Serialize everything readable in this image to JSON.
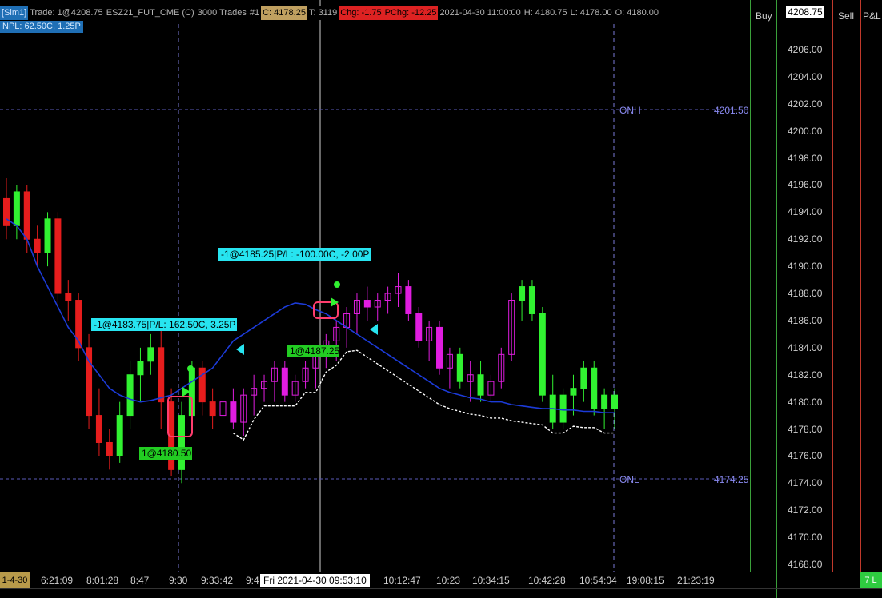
{
  "header": {
    "sim": "[Sim1]",
    "trade": "Trade: 1@4208.75",
    "instrument": "ESZ21_FUT_CME (C)",
    "bars": "3000 Trades",
    "num": "#1",
    "close": "C: 4178.25",
    "t": "T: 3119",
    "chg": "Chg: -1.75",
    "pchg": "PChg: -12.25",
    "datetime": "2021-04-30 11:00:00",
    "high": "H: 4180.75",
    "low": "L: 4178.00",
    "open": "O: 4180.00"
  },
  "npl": "NPL: 62.50C, 1.25P",
  "columns": {
    "buy": "Buy",
    "sell": "Sell",
    "pnl": "P&L"
  },
  "current_price": "4208.75",
  "pnl_badge": "7 L",
  "date_left": "1-4-30",
  "crosshair_date": "Fri 2021-04-30  09:53:10",
  "colors": {
    "bull": "#31f231",
    "bear": "#e61d1d",
    "up_trend": "#e01de0",
    "cyan": "#27e4f0",
    "ma": "#1c3bd8",
    "grid": "#5a5ab8"
  },
  "levels": [
    {
      "name": "ONH",
      "value": "4201.50"
    },
    {
      "name": "ONL",
      "value": "4174.25"
    }
  ],
  "annotations": [
    {
      "text": "-1@4185.25|P/L: -100.00C, -2.00P",
      "kind": "exit"
    },
    {
      "text": "-1@4183.75|P/L: 162.50C, 3.25P",
      "kind": "exit"
    },
    {
      "text": "1@4187.25",
      "kind": "entry"
    },
    {
      "text": "1@4180.50",
      "kind": "entry"
    }
  ],
  "chart_data": {
    "type": "candlestick",
    "y_ticks": [
      "4206.00",
      "4204.00",
      "4202.00",
      "4200.00",
      "4198.00",
      "4196.00",
      "4194.00",
      "4192.00",
      "4190.00",
      "4188.00",
      "4186.00",
      "4184.00",
      "4182.00",
      "4180.00",
      "4178.00",
      "4176.00",
      "4174.00",
      "4172.00",
      "4170.00",
      "4168.00"
    ],
    "y_range": [
      4167,
      4208
    ],
    "x_ticks": [
      "6:21:09",
      "8:01:28",
      "8:47",
      "9:30",
      "9:33:42",
      "9:4",
      "10:12:47",
      "10:23",
      "10:34:15",
      "10:42:28",
      "10:54:04",
      "19:08:15",
      "21:23:19"
    ],
    "candles": [
      [
        4195,
        4196.5,
        4192,
        4193
      ],
      [
        4193,
        4196,
        4192,
        4195.5
      ],
      [
        4195.5,
        4196,
        4191,
        4192
      ],
      [
        4192,
        4193,
        4190,
        4191
      ],
      [
        4191,
        4194,
        4190,
        4193.5
      ],
      [
        4193.5,
        4194,
        4187,
        4188
      ],
      [
        4188,
        4189,
        4186,
        4187.5
      ],
      [
        4187.5,
        4188,
        4183,
        4184
      ],
      [
        4184,
        4185,
        4178,
        4179
      ],
      [
        4179,
        4181,
        4176,
        4177
      ],
      [
        4177,
        4178,
        4175,
        4176
      ],
      [
        4176,
        4180,
        4175.5,
        4179
      ],
      [
        4179,
        4183,
        4178,
        4182
      ],
      [
        4182,
        4184,
        4180,
        4183
      ],
      [
        4183,
        4185,
        4182,
        4184
      ],
      [
        4184,
        4185.5,
        4178,
        4180
      ],
      [
        4180,
        4181,
        4174.5,
        4175
      ],
      [
        4175,
        4180,
        4174,
        4179
      ],
      [
        4179,
        4183,
        4178,
        4182.5
      ],
      [
        4182.5,
        4183,
        4179,
        4180
      ],
      [
        4180,
        4181,
        4178,
        4179
      ],
      [
        4179,
        4181,
        4177,
        4180
      ],
      [
        4180,
        4181,
        4178,
        4178.5
      ],
      [
        4178.5,
        4181,
        4177.5,
        4180.5
      ],
      [
        4180.5,
        4182,
        4179,
        4181
      ],
      [
        4181,
        4182,
        4180,
        4181.5
      ],
      [
        4181.5,
        4183,
        4180,
        4182.5
      ],
      [
        4182.5,
        4183,
        4180,
        4180.5
      ],
      [
        4180.5,
        4182,
        4180,
        4181.5
      ],
      [
        4181.5,
        4183,
        4181,
        4182.5
      ],
      [
        4182.5,
        4184,
        4181,
        4183.5
      ],
      [
        4183.5,
        4185,
        4182.5,
        4184.5
      ],
      [
        4184.5,
        4186,
        4183,
        4185.5
      ],
      [
        4185.5,
        4187,
        4184,
        4186.5
      ],
      [
        4186.5,
        4188,
        4185,
        4187.5
      ],
      [
        4187.5,
        4188.5,
        4186,
        4187
      ],
      [
        4187,
        4188,
        4186,
        4187.5
      ],
      [
        4187.5,
        4188.5,
        4186.5,
        4188
      ],
      [
        4188,
        4189.5,
        4187,
        4188.5
      ],
      [
        4188.5,
        4189,
        4186,
        4186.5
      ],
      [
        4186.5,
        4187,
        4184,
        4184.5
      ],
      [
        4184.5,
        4186,
        4183,
        4185.5
      ],
      [
        4185.5,
        4186,
        4182,
        4182.5
      ],
      [
        4182.5,
        4184,
        4181,
        4183.5
      ],
      [
        4183.5,
        4184,
        4181,
        4181.5
      ],
      [
        4181.5,
        4183,
        4180,
        4182
      ],
      [
        4182,
        4183,
        4180,
        4180.5
      ],
      [
        4180.5,
        4182,
        4180,
        4181.5
      ],
      [
        4181.5,
        4184,
        4181,
        4183.5
      ],
      [
        4183.5,
        4188,
        4183,
        4187.5
      ],
      [
        4187.5,
        4189,
        4186,
        4188.5
      ],
      [
        4188.5,
        4189,
        4186,
        4186.5
      ],
      [
        4186.5,
        4187,
        4180,
        4180.5
      ],
      [
        4180.5,
        4182,
        4178,
        4178.5
      ],
      [
        4178.5,
        4181,
        4178,
        4180.5
      ],
      [
        4180.5,
        4182,
        4179,
        4181
      ],
      [
        4181,
        4183,
        4180,
        4182.5
      ],
      [
        4182.5,
        4183,
        4179,
        4179.5
      ],
      [
        4179.5,
        4181,
        4178,
        4180.5
      ],
      [
        4180.5,
        4181,
        4178,
        4179.5
      ]
    ],
    "ma": [
      4193.5,
      4193,
      4192,
      4190,
      4188.5,
      4187,
      4185.5,
      4184.5,
      4183,
      4182,
      4181,
      4180.5,
      4180.2,
      4180,
      4180.1,
      4180.3,
      4180.5,
      4181,
      4181.5,
      4182,
      4182.5,
      4183.5,
      4184.5,
      4185,
      4185.5,
      4186,
      4186.5,
      4187,
      4187.3,
      4187.2,
      4186.8,
      4186.5,
      4186,
      4185.5,
      4185,
      4184.5,
      4184,
      4183.5,
      4183,
      4182.5,
      4182,
      4181.5,
      4181,
      4180.7,
      4180.5,
      4180.3,
      4180.2,
      4180,
      4180,
      4179.8,
      4179.7,
      4179.6,
      4179.5,
      4179.5,
      4179.4,
      4179.4,
      4179.3,
      4179.3,
      4179.2,
      4179.2
    ]
  }
}
